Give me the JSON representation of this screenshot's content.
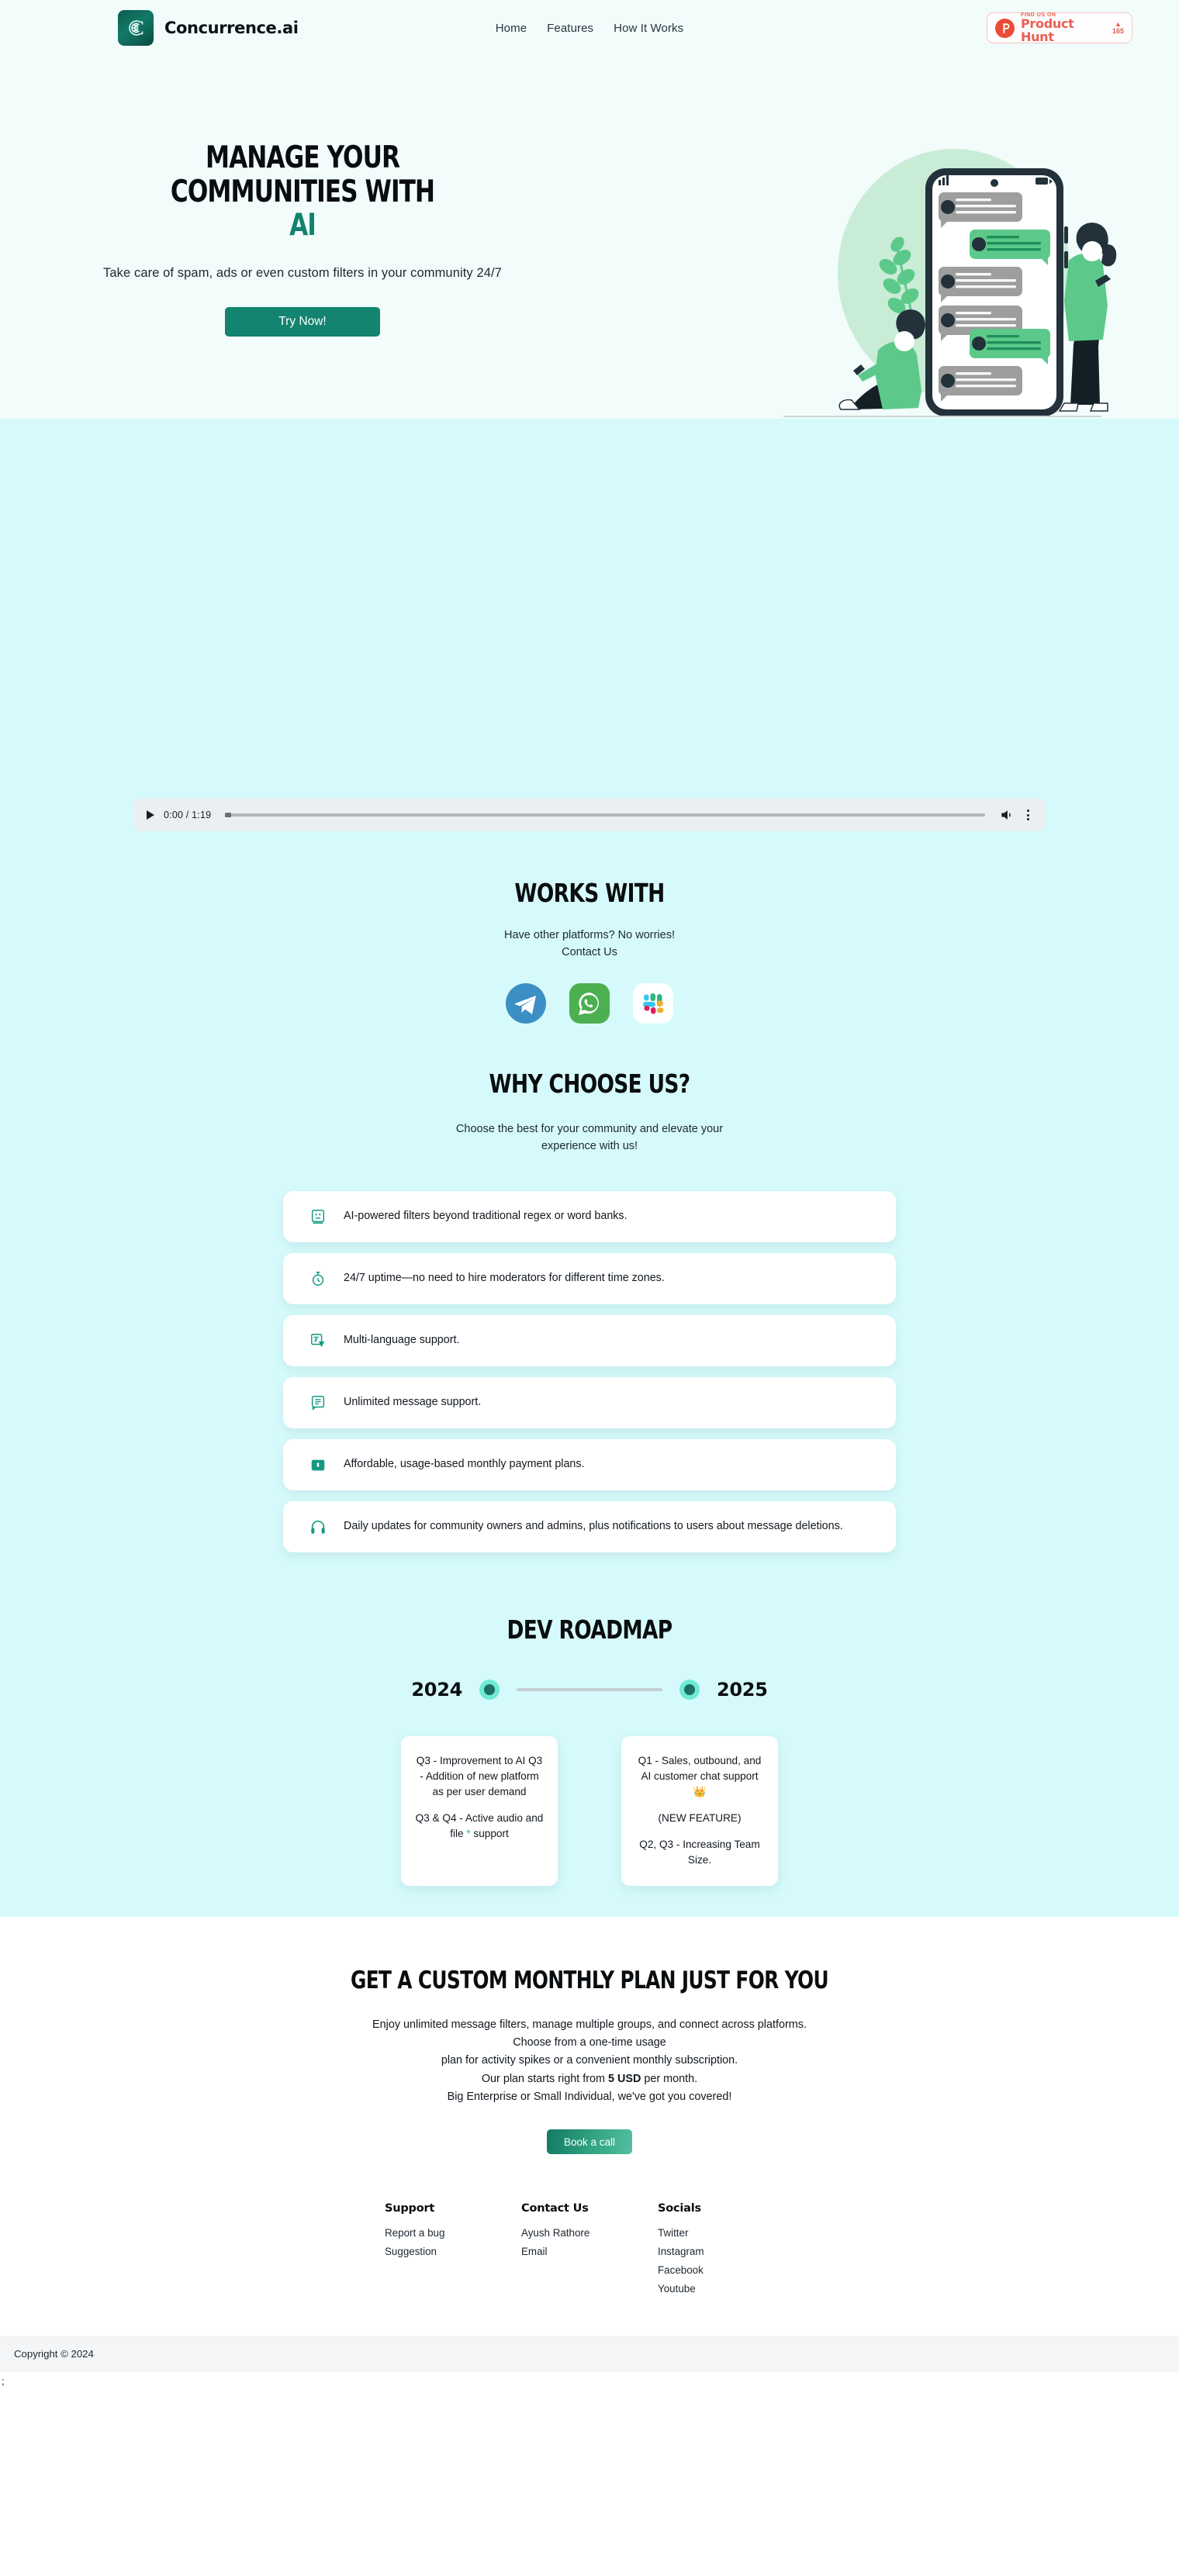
{
  "header": {
    "brand": "Concurrence.ai",
    "logo_icon": "circuit-c-logo-icon",
    "nav": [
      {
        "label": "Home"
      },
      {
        "label": "Features"
      },
      {
        "label": "How It Works"
      }
    ],
    "product_hunt": {
      "small_text": "FIND US ON",
      "big_text": "Product Hunt",
      "arrow": "▲",
      "votes": "165"
    }
  },
  "hero": {
    "title_line1": "MANAGE YOUR COMMUNITIES WITH",
    "title_accent": "AI",
    "subtitle": "Take care of spam, ads or even custom filters in your community 24/7",
    "cta_label": "Try Now!",
    "illustration": "people-chatting-phone-illustration"
  },
  "video": {
    "play_icon": "play-icon",
    "time": "0:00 / 1:19",
    "volume_icon": "volume-icon",
    "menu_icon": "more-options-icon",
    "progress_percent": 0
  },
  "works_with": {
    "title": "WORKS WITH",
    "sub_line1": "Have other platforms? No worries!",
    "sub_line2": "Contact Us",
    "platforms": [
      {
        "name": "Telegram",
        "icon": "telegram-icon"
      },
      {
        "name": "WhatsApp",
        "icon": "whatsapp-icon"
      },
      {
        "name": "Slack",
        "icon": "slack-icon"
      }
    ]
  },
  "why_choose": {
    "title": "WHY CHOOSE US?",
    "sub_line1": "Choose the best for your community and elevate your",
    "sub_line2": "experience with us!",
    "features": [
      {
        "icon": "emoji-face-icon",
        "text": "AI-powered filters beyond traditional regex or word banks."
      },
      {
        "icon": "timer-icon",
        "text": "24/7 uptime—no need to hire moderators for different time zones."
      },
      {
        "icon": "translate-icon",
        "text": "Multi-language support."
      },
      {
        "icon": "message-lines-icon",
        "text": "Unlimited message support."
      },
      {
        "icon": "wallet-icon",
        "text": "Affordable, usage-based monthly payment plans."
      },
      {
        "icon": "headphones-icon",
        "text": "Daily updates for community owners and admins, plus notifications to users about message deletions."
      }
    ]
  },
  "roadmap": {
    "title": "DEV ROADMAP",
    "year_start": "2024",
    "year_end": "2025",
    "cards": [
      {
        "lines": [
          {
            "text": "Q3 - Improvement to AI\nQ3 - Addition of new platform as per user demand"
          },
          {
            "text": "Q3 & Q4 - Active audio and file ",
            "star": "*",
            "tail": " support"
          }
        ]
      },
      {
        "lines": [
          {
            "text": "Q1 - Sales, outbound, and AI customer chat support 👑"
          },
          {
            "text": "(NEW FEATURE)"
          },
          {
            "text": "Q2, Q3 - Increasing Team Size."
          }
        ]
      }
    ]
  },
  "pricing": {
    "title": "GET A CUSTOM MONTHLY PLAN JUST FOR YOU",
    "line1": "Enjoy unlimited message filters, manage multiple groups, and connect across platforms.",
    "line2": "Choose from a one-time usage",
    "line3": "plan for activity spikes or a convenient monthly subscription.",
    "line4_pre": "Our plan starts right from ",
    "line4_bold": "5 USD",
    "line4_post": " per month.",
    "line5": "Big Enterprise or Small Individual, we've got you covered!",
    "cta_label": "Book a call"
  },
  "footer": {
    "columns": [
      {
        "heading": "Support",
        "links": [
          "Report a bug",
          "Suggestion"
        ]
      },
      {
        "heading": "Contact Us",
        "links": [
          "Ayush Rathore",
          "Email"
        ]
      },
      {
        "heading": "Socials",
        "links": [
          "Twitter",
          "Instagram",
          "Facebook",
          "Youtube"
        ]
      }
    ],
    "copyright": "Copyright © 2024",
    "stray_text": ";"
  },
  "colors": {
    "hero_bg": "#F1FCFB",
    "cyan_bg": "#D6FAFB",
    "accent_teal": "#13846f",
    "dot_teal": "#6DEBD5",
    "product_hunt_red": "#ea5f52"
  }
}
